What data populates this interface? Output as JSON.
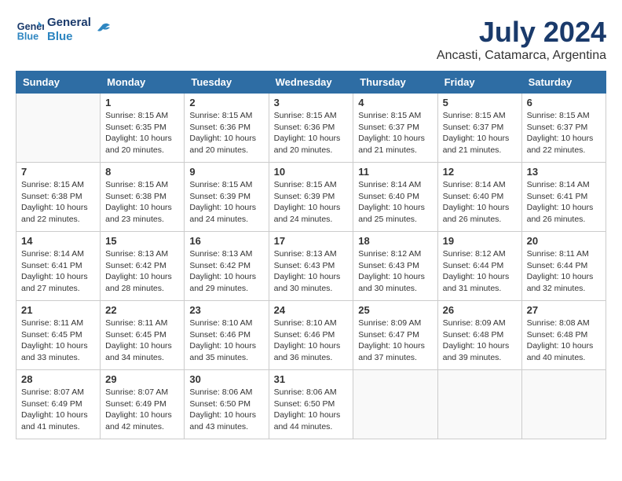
{
  "logo": {
    "text_general": "General",
    "text_blue": "Blue"
  },
  "title": {
    "month_year": "July 2024",
    "location": "Ancasti, Catamarca, Argentina"
  },
  "weekdays": [
    "Sunday",
    "Monday",
    "Tuesday",
    "Wednesday",
    "Thursday",
    "Friday",
    "Saturday"
  ],
  "weeks": [
    [
      {
        "day": "",
        "info": ""
      },
      {
        "day": "1",
        "info": "Sunrise: 8:15 AM\nSunset: 6:35 PM\nDaylight: 10 hours\nand 20 minutes."
      },
      {
        "day": "2",
        "info": "Sunrise: 8:15 AM\nSunset: 6:36 PM\nDaylight: 10 hours\nand 20 minutes."
      },
      {
        "day": "3",
        "info": "Sunrise: 8:15 AM\nSunset: 6:36 PM\nDaylight: 10 hours\nand 20 minutes."
      },
      {
        "day": "4",
        "info": "Sunrise: 8:15 AM\nSunset: 6:37 PM\nDaylight: 10 hours\nand 21 minutes."
      },
      {
        "day": "5",
        "info": "Sunrise: 8:15 AM\nSunset: 6:37 PM\nDaylight: 10 hours\nand 21 minutes."
      },
      {
        "day": "6",
        "info": "Sunrise: 8:15 AM\nSunset: 6:37 PM\nDaylight: 10 hours\nand 22 minutes."
      }
    ],
    [
      {
        "day": "7",
        "info": "Sunrise: 8:15 AM\nSunset: 6:38 PM\nDaylight: 10 hours\nand 22 minutes."
      },
      {
        "day": "8",
        "info": "Sunrise: 8:15 AM\nSunset: 6:38 PM\nDaylight: 10 hours\nand 23 minutes."
      },
      {
        "day": "9",
        "info": "Sunrise: 8:15 AM\nSunset: 6:39 PM\nDaylight: 10 hours\nand 24 minutes."
      },
      {
        "day": "10",
        "info": "Sunrise: 8:15 AM\nSunset: 6:39 PM\nDaylight: 10 hours\nand 24 minutes."
      },
      {
        "day": "11",
        "info": "Sunrise: 8:14 AM\nSunset: 6:40 PM\nDaylight: 10 hours\nand 25 minutes."
      },
      {
        "day": "12",
        "info": "Sunrise: 8:14 AM\nSunset: 6:40 PM\nDaylight: 10 hours\nand 26 minutes."
      },
      {
        "day": "13",
        "info": "Sunrise: 8:14 AM\nSunset: 6:41 PM\nDaylight: 10 hours\nand 26 minutes."
      }
    ],
    [
      {
        "day": "14",
        "info": "Sunrise: 8:14 AM\nSunset: 6:41 PM\nDaylight: 10 hours\nand 27 minutes."
      },
      {
        "day": "15",
        "info": "Sunrise: 8:13 AM\nSunset: 6:42 PM\nDaylight: 10 hours\nand 28 minutes."
      },
      {
        "day": "16",
        "info": "Sunrise: 8:13 AM\nSunset: 6:42 PM\nDaylight: 10 hours\nand 29 minutes."
      },
      {
        "day": "17",
        "info": "Sunrise: 8:13 AM\nSunset: 6:43 PM\nDaylight: 10 hours\nand 30 minutes."
      },
      {
        "day": "18",
        "info": "Sunrise: 8:12 AM\nSunset: 6:43 PM\nDaylight: 10 hours\nand 30 minutes."
      },
      {
        "day": "19",
        "info": "Sunrise: 8:12 AM\nSunset: 6:44 PM\nDaylight: 10 hours\nand 31 minutes."
      },
      {
        "day": "20",
        "info": "Sunrise: 8:11 AM\nSunset: 6:44 PM\nDaylight: 10 hours\nand 32 minutes."
      }
    ],
    [
      {
        "day": "21",
        "info": "Sunrise: 8:11 AM\nSunset: 6:45 PM\nDaylight: 10 hours\nand 33 minutes."
      },
      {
        "day": "22",
        "info": "Sunrise: 8:11 AM\nSunset: 6:45 PM\nDaylight: 10 hours\nand 34 minutes."
      },
      {
        "day": "23",
        "info": "Sunrise: 8:10 AM\nSunset: 6:46 PM\nDaylight: 10 hours\nand 35 minutes."
      },
      {
        "day": "24",
        "info": "Sunrise: 8:10 AM\nSunset: 6:46 PM\nDaylight: 10 hours\nand 36 minutes."
      },
      {
        "day": "25",
        "info": "Sunrise: 8:09 AM\nSunset: 6:47 PM\nDaylight: 10 hours\nand 37 minutes."
      },
      {
        "day": "26",
        "info": "Sunrise: 8:09 AM\nSunset: 6:48 PM\nDaylight: 10 hours\nand 39 minutes."
      },
      {
        "day": "27",
        "info": "Sunrise: 8:08 AM\nSunset: 6:48 PM\nDaylight: 10 hours\nand 40 minutes."
      }
    ],
    [
      {
        "day": "28",
        "info": "Sunrise: 8:07 AM\nSunset: 6:49 PM\nDaylight: 10 hours\nand 41 minutes."
      },
      {
        "day": "29",
        "info": "Sunrise: 8:07 AM\nSunset: 6:49 PM\nDaylight: 10 hours\nand 42 minutes."
      },
      {
        "day": "30",
        "info": "Sunrise: 8:06 AM\nSunset: 6:50 PM\nDaylight: 10 hours\nand 43 minutes."
      },
      {
        "day": "31",
        "info": "Sunrise: 8:06 AM\nSunset: 6:50 PM\nDaylight: 10 hours\nand 44 minutes."
      },
      {
        "day": "",
        "info": ""
      },
      {
        "day": "",
        "info": ""
      },
      {
        "day": "",
        "info": ""
      }
    ]
  ]
}
